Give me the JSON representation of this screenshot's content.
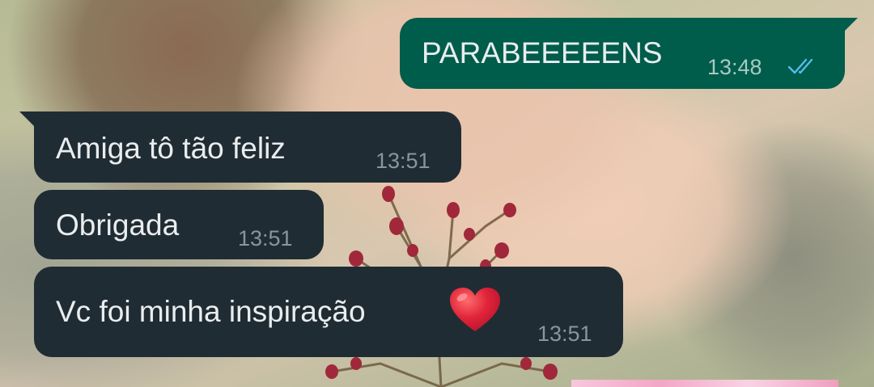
{
  "chat": {
    "messages": [
      {
        "direction": "outgoing",
        "text": "PARABEEEEENS",
        "time": "13:48",
        "status": "read-double-check-icon"
      },
      {
        "direction": "incoming",
        "text": "Amiga tô tão feliz",
        "time": "13:51"
      },
      {
        "direction": "incoming",
        "text": "Obrigada",
        "time": "13:51"
      },
      {
        "direction": "incoming",
        "text": "Vc foi minha inspiração",
        "time": "13:51",
        "emoji": "red-heart-icon"
      }
    ]
  },
  "colors": {
    "incoming_bubble": "#202c33",
    "outgoing_bubble": "#005c4b",
    "text": "#e9edef",
    "read_ticks": "#53bdeb",
    "heart": "#e0243a"
  }
}
